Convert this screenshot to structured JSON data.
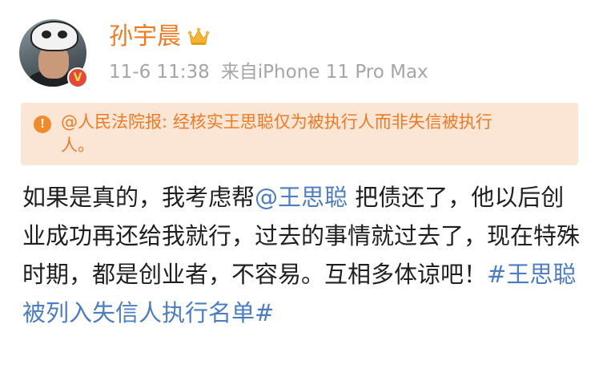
{
  "post": {
    "username": "孙宇晨",
    "timestamp": "11-6 11:38",
    "source": "来自iPhone 11 Pro Max",
    "notice": "@人民法院报: 经核实王思聪仅为被执行人而非失信被执行人。",
    "content": {
      "part1": "如果是真的，我考虑帮",
      "mention": "@王思聪",
      "part2": " 把债还了，他以后创业成功再还给我就行，过去的事情就过去了，现在特殊时期，都是创业者，不容易。互相多体谅吧！",
      "hashtag": "#王思聪被列入失信人执行名单#"
    }
  },
  "colors": {
    "username": "#f07a22",
    "meta": "#a5a5a5",
    "notice_bg": "#fbe6d6",
    "notice_text": "#ee7a26",
    "link": "#4d7cc0",
    "body_text": "#1f1f1f"
  },
  "icons": {
    "crown": "crown-icon",
    "verified": "verified-badge-icon",
    "notice": "alert-circle-icon"
  }
}
